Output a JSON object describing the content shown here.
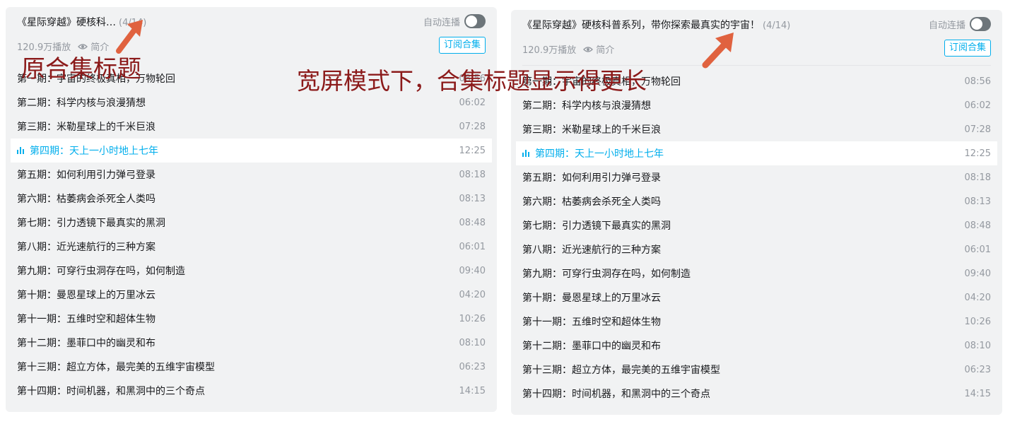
{
  "panels": {
    "left": {
      "title": "《星际穿越》硬核科…",
      "count": "(4/14)",
      "autoplay_label": "自动连播",
      "views": "120.9万播放",
      "intro_label": "简介",
      "subscribe_label": "订阅合集",
      "episodes": [
        {
          "title": "第一期：宇宙的终极真相，万物轮回",
          "duration": "08:56"
        },
        {
          "title": "第二期：科学内核与浪漫猜想",
          "duration": "06:02"
        },
        {
          "title": "第三期：米勒星球上的千米巨浪",
          "duration": "07:28"
        },
        {
          "title": "第四期：天上一小时地上七年",
          "duration": "12:25"
        },
        {
          "title": "第五期：如何利用引力弹弓登录",
          "duration": "08:18"
        },
        {
          "title": "第六期：枯萎病会杀死全人类吗",
          "duration": "08:13"
        },
        {
          "title": "第七期：引力透镜下最真实的黑洞",
          "duration": "08:48"
        },
        {
          "title": "第八期：近光速航行的三种方案",
          "duration": "06:01"
        },
        {
          "title": "第九期：可穿行虫洞存在吗，如何制造",
          "duration": "09:40"
        },
        {
          "title": "第十期：曼恩星球上的万里冰云",
          "duration": "04:20"
        },
        {
          "title": "第十一期：五维时空和超体生物",
          "duration": "10:26"
        },
        {
          "title": "第十二期：墨菲口中的幽灵和布",
          "duration": "08:10"
        },
        {
          "title": "第十三期：超立方体，最完美的五维宇宙模型",
          "duration": "06:23"
        },
        {
          "title": "第十四期：时间机器，和黑洞中的三个奇点",
          "duration": "14:15"
        }
      ]
    },
    "right": {
      "title": "《星际穿越》硬核科普系列，带你探索最真实的宇宙！",
      "count": "(4/14)",
      "autoplay_label": "自动连播",
      "views": "120.9万播放",
      "intro_label": "简介",
      "subscribe_label": "订阅合集",
      "episodes": [
        {
          "title": "第一期：宇宙的终极真相，万物轮回",
          "duration": "08:56"
        },
        {
          "title": "第二期：科学内核与浪漫猜想",
          "duration": "06:02"
        },
        {
          "title": "第三期：米勒星球上的千米巨浪",
          "duration": "07:28"
        },
        {
          "title": "第四期：天上一小时地上七年",
          "duration": "12:25"
        },
        {
          "title": "第五期：如何利用引力弹弓登录",
          "duration": "08:18"
        },
        {
          "title": "第六期：枯萎病会杀死全人类吗",
          "duration": "08:13"
        },
        {
          "title": "第七期：引力透镜下最真实的黑洞",
          "duration": "08:48"
        },
        {
          "title": "第八期：近光速航行的三种方案",
          "duration": "06:01"
        },
        {
          "title": "第九期：可穿行虫洞存在吗，如何制造",
          "duration": "09:40"
        },
        {
          "title": "第十期：曼恩星球上的万里冰云",
          "duration": "04:20"
        },
        {
          "title": "第十一期：五维时空和超体生物",
          "duration": "10:26"
        },
        {
          "title": "第十二期：墨菲口中的幽灵和布",
          "duration": "08:10"
        },
        {
          "title": "第十三期：超立方体，最完美的五维宇宙模型",
          "duration": "06:23"
        },
        {
          "title": "第十四期：时间机器，和黑洞中的三个奇点",
          "duration": "14:15"
        }
      ]
    }
  },
  "active_episode_index": 3,
  "annotations": {
    "left_label": "原合集标题",
    "center_label": "宽屏模式下，合集标题显示得更长"
  },
  "colors": {
    "accent": "#00aeec",
    "annotation": "#8b1a1a",
    "arrow": "#e0623f",
    "panel_bg": "#f1f2f3"
  },
  "icons": {
    "eye": "eye-icon",
    "playing": "playing-bars-icon",
    "arrow": "arrow-up-right-icon"
  }
}
